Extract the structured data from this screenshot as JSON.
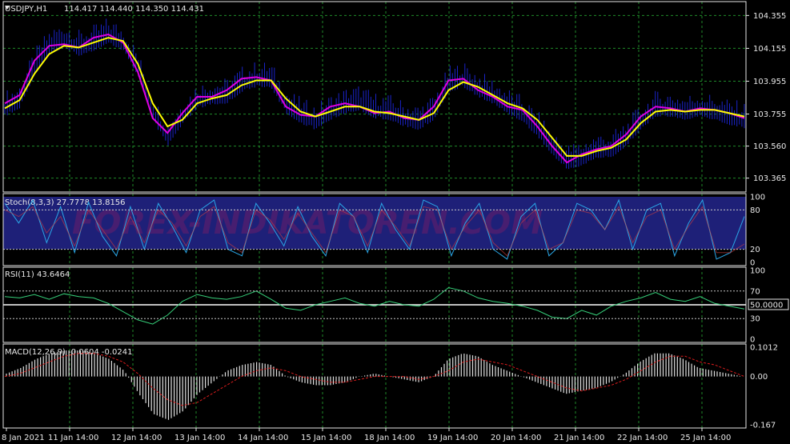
{
  "colors": {
    "background": "#000000",
    "grid": "#1f8a2a",
    "frame": "#e6e6e6",
    "price_bars": "#1a23c8",
    "ma_fast": "#e000e0",
    "ma_slow": "#ffff00",
    "stoch_band": "#1e2078",
    "stoch_line": "#2aa6e6",
    "rsi_line": "#36d07a",
    "macd_hist": "#e0e0e0",
    "macd_signal": "#d81c1c"
  },
  "watermark": "FOREX-INDIKATOREN.COM",
  "chart_data": [
    {
      "type": "line",
      "panel": "price",
      "title": "USDJPY,H1",
      "ohlc": "114.417 114.440 114.350 114.431",
      "ylim": [
        103.3,
        104.42
      ],
      "y_ticks": [
        "104.355",
        "104.155",
        "103.955",
        "103.755",
        "103.560",
        "103.365"
      ],
      "x_ticks": [
        "8 Jan 2021",
        "11 Jan 14:00",
        "12 Jan 14:00",
        "13 Jan 14:00",
        "14 Jan 14:00",
        "15 Jan 14:00",
        "18 Jan 14:00",
        "19 Jan 14:00",
        "20 Jan 14:00",
        "21 Jan 14:00",
        "22 Jan 14:00",
        "25 Jan 14:00"
      ],
      "grid": true,
      "series": [
        {
          "style": "bars",
          "values": [
            103.8,
            103.85,
            104.05,
            104.18,
            104.22,
            104.17,
            104.2,
            104.25,
            104.2,
            104.05,
            103.78,
            103.62,
            103.75,
            103.85,
            103.87,
            103.88,
            103.95,
            103.98,
            103.98,
            103.82,
            103.76,
            103.72,
            103.78,
            103.82,
            103.84,
            103.79,
            103.78,
            103.74,
            103.72,
            103.78,
            103.95,
            103.98,
            103.92,
            103.88,
            103.82,
            103.77,
            103.68,
            103.57,
            103.48,
            103.5,
            103.55,
            103.55,
            103.62,
            103.72,
            103.8,
            103.8,
            103.78,
            103.8,
            103.78,
            103.75,
            103.73
          ]
        },
        {
          "style": "line",
          "values": [
            103.82,
            103.87,
            104.08,
            104.17,
            104.18,
            104.16,
            104.22,
            104.24,
            104.19,
            104.01,
            103.73,
            103.64,
            103.76,
            103.86,
            103.86,
            103.9,
            103.97,
            103.98,
            103.96,
            103.8,
            103.75,
            103.74,
            103.8,
            103.82,
            103.8,
            103.76,
            103.77,
            103.73,
            103.72,
            103.8,
            103.96,
            103.97,
            103.9,
            103.86,
            103.8,
            103.78,
            103.68,
            103.56,
            103.46,
            103.51,
            103.54,
            103.56,
            103.63,
            103.74,
            103.8,
            103.79,
            103.77,
            103.79,
            103.78,
            103.76,
            103.73
          ]
        },
        {
          "style": "line",
          "values": [
            103.79,
            103.84,
            104.0,
            104.12,
            104.17,
            104.16,
            104.19,
            104.22,
            104.2,
            104.06,
            103.82,
            103.68,
            103.72,
            103.82,
            103.85,
            103.87,
            103.93,
            103.96,
            103.96,
            103.85,
            103.77,
            103.74,
            103.77,
            103.8,
            103.8,
            103.77,
            103.76,
            103.74,
            103.72,
            103.76,
            103.9,
            103.95,
            103.92,
            103.87,
            103.82,
            103.79,
            103.72,
            103.61,
            103.5,
            103.5,
            103.53,
            103.55,
            103.6,
            103.7,
            103.77,
            103.78,
            103.77,
            103.78,
            103.78,
            103.76,
            103.74
          ]
        }
      ]
    },
    {
      "type": "line",
      "panel": "stochastic",
      "title": "Stoch(8,3,3) 27.7778 13.8156",
      "ylim": [
        0,
        100
      ],
      "y_ticks": [
        "100",
        "80",
        "20",
        "0"
      ],
      "levels": [
        80,
        20
      ],
      "series": [
        {
          "values": [
            90,
            60,
            95,
            30,
            85,
            15,
            92,
            40,
            10,
            85,
            20,
            90,
            55,
            15,
            80,
            95,
            20,
            10,
            90,
            60,
            25,
            85,
            40,
            10,
            90,
            70,
            15,
            90,
            50,
            20,
            95,
            85,
            10,
            60,
            90,
            20,
            5,
            70,
            90,
            10,
            30,
            90,
            80,
            50,
            95,
            20,
            80,
            90,
            10,
            60,
            95,
            5,
            15,
            70
          ]
        },
        {
          "values": [
            80,
            70,
            85,
            45,
            70,
            25,
            80,
            50,
            20,
            70,
            30,
            80,
            60,
            25,
            70,
            85,
            30,
            15,
            80,
            65,
            35,
            75,
            45,
            15,
            80,
            70,
            25,
            80,
            55,
            25,
            85,
            80,
            20,
            55,
            80,
            30,
            10,
            60,
            80,
            20,
            30,
            80,
            75,
            50,
            85,
            30,
            70,
            80,
            20,
            55,
            85,
            15,
            15,
            28
          ]
        }
      ]
    },
    {
      "type": "line",
      "panel": "rsi",
      "title": "RSI(11) 43.6464",
      "ylim": [
        0,
        100
      ],
      "y_ticks": [
        "100",
        "70",
        "50.0000",
        "30",
        "0"
      ],
      "levels": [
        70,
        50,
        30
      ],
      "series": [
        {
          "values": [
            62,
            60,
            65,
            58,
            66,
            62,
            60,
            52,
            40,
            28,
            22,
            35,
            55,
            65,
            60,
            58,
            62,
            70,
            58,
            45,
            42,
            50,
            55,
            60,
            52,
            48,
            55,
            50,
            48,
            58,
            75,
            70,
            60,
            55,
            52,
            48,
            42,
            32,
            30,
            42,
            35,
            48,
            55,
            60,
            68,
            58,
            55,
            62,
            52,
            48,
            44
          ]
        }
      ]
    },
    {
      "type": "bar",
      "panel": "macd",
      "title": "MACD(12,26,9) -0.0604 -0.0241",
      "ylim": [
        -0.167,
        0.1012
      ],
      "y_ticks": [
        "0.1012",
        "0.00",
        "-0.167"
      ],
      "series": [
        {
          "style": "histogram",
          "values": [
            0.01,
            0.03,
            0.06,
            0.08,
            0.09,
            0.09,
            0.08,
            0.06,
            0.02,
            -0.06,
            -0.13,
            -0.15,
            -0.12,
            -0.06,
            -0.02,
            0.02,
            0.04,
            0.05,
            0.04,
            0.0,
            -0.02,
            -0.03,
            -0.03,
            -0.02,
            0.0,
            0.01,
            0.0,
            -0.01,
            -0.02,
            0.0,
            0.06,
            0.08,
            0.07,
            0.04,
            0.02,
            0.0,
            -0.02,
            -0.04,
            -0.06,
            -0.05,
            -0.04,
            -0.02,
            0.01,
            0.05,
            0.08,
            0.08,
            0.06,
            0.03,
            0.02,
            0.01,
            0.0
          ]
        },
        {
          "style": "line",
          "values": [
            0.0,
            0.01,
            0.03,
            0.05,
            0.07,
            0.08,
            0.08,
            0.07,
            0.05,
            0.01,
            -0.04,
            -0.08,
            -0.1,
            -0.09,
            -0.06,
            -0.03,
            0.0,
            0.02,
            0.03,
            0.02,
            0.0,
            -0.01,
            -0.02,
            -0.02,
            -0.01,
            0.0,
            0.0,
            0.0,
            -0.01,
            0.0,
            0.02,
            0.05,
            0.06,
            0.05,
            0.04,
            0.02,
            0.0,
            -0.02,
            -0.04,
            -0.05,
            -0.04,
            -0.03,
            -0.01,
            0.02,
            0.05,
            0.07,
            0.07,
            0.05,
            0.04,
            0.02,
            0.0
          ]
        }
      ]
    }
  ]
}
